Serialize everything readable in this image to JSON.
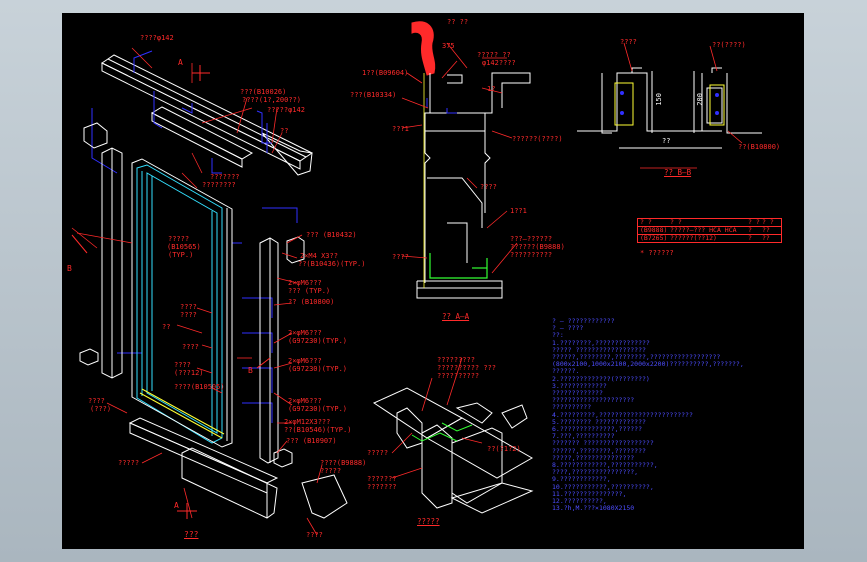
{
  "drawing": {
    "main_title": "???",
    "detail_title": "?????",
    "section_aa": "?? A—A",
    "section_bb": "?? B—B"
  },
  "callouts_left": {
    "top_rail": "????φ142",
    "b810055": "???(B10026)",
    "b810055_sub": "????(1?,200??)",
    "phi142": "?????φ142",
    "q2": "??",
    "quote3": "???????",
    "quote3b": "????????",
    "screw1": "?????",
    "b10565": "(B10565)",
    "b10565_typ": "(TYP.)",
    "b10432": "??? (B10432)",
    "screw_m4": "2×M4 X3??",
    "screw_m4_typ": "??(B10436)(TYP.)",
    "screw_m6_1": "2×φM6???",
    "screw_m6_1_typ": "??? (TYP.)",
    "b10800": "?? (B10800)",
    "m6_2": "2×φM6???",
    "m6_2_typ": "(G97230)(TYP.)",
    "m6_3": "2×φM6???",
    "m6_3_typ": "(G97230)(TYP.)",
    "m6_4": "2×φM6???",
    "m6_4_typ": "(G97230)(TYP.)",
    "m12": "2×φM12X3???",
    "m12_typ": "??(B10546)(TYP.)",
    "b10907": "??? (B10907)",
    "mid_1": "????",
    "mid_2": "????",
    "mid_3": "??",
    "mid_4": "????",
    "mid_5": "????",
    "mid_6": "(???12)",
    "b10505": "????(B10505)",
    "bot_1": "????",
    "bot_1b": "(???)",
    "bot_2": "?????",
    "profile_1": "????(B9888)",
    "profile_2": "?????",
    "profile_3": "????",
    "arrow_b": "B",
    "arrow_a": "A"
  },
  "callouts_mid": {
    "top_r1": "?? ??",
    "dim_top": "375",
    "r2": "????? ??",
    "r2b": "φ142????",
    "r3": "1??(B09604)",
    "r4": "???(B10334)",
    "r5": "???1",
    "r6": "1?",
    "r7": "??????(????)",
    "r8": "????",
    "r9": "1??1",
    "r10": "???—??????",
    "r10b": "??????(B9888)",
    "r10c": "??????????",
    "r11": "????",
    "r12": "??????? ???",
    "r13": "?????"
  },
  "callouts_detail": {
    "d1": "?????????",
    "d1b": "?????????? ???",
    "d1c": "??????????",
    "d2": "??(?1?2)",
    "d3": "?????",
    "d4": "???????",
    "d5": "???????"
  },
  "section_bb_labels": {
    "l1": "????",
    "l2": "??(????)",
    "dim_150": "150",
    "dim_200": "200",
    "dim_10": "??",
    "b10800": "??(B10800)"
  },
  "table": {
    "header": [
      "? ?",
      "? ?",
      "? ?",
      "? ?"
    ],
    "rows": [
      [
        "(B9888)",
        "?????—??? HCA HCA",
        "?",
        "??"
      ],
      [
        "(B7265)",
        "??????(??12)",
        "?",
        "??"
      ]
    ],
    "note": "* ??????"
  },
  "notes": [
    "? — ????????????",
    "? — ????",
    "??:",
    "1.????????,??????????????",
    "  ?????  ??????????????????",
    "  ??????,????????,????????,??????????????????",
    "  (800x2100,1000x2100,2000x2200)??????????,???????,",
    "  ??????.",
    "2.?????????????(????????)",
    "3.????????????",
    "  ?????????????",
    "  ?????????????????????",
    "    ??????????",
    "4.?????????,????????????????????????",
    "5.???????? ?????????????",
    "6.??????????????,??????",
    "7.???,??????????",
    "  ???????  ??????????????????",
    "  ??????,????????,????????",
    "  ?????,???????????????",
    "8.????????????,???????????,",
    "  ????,????????????????,",
    "9.????????????,",
    "10.???????????,??????????,",
    "11.???????????????,",
    "12.??????????,",
    "13.?h,M.???×1080X2150"
  ],
  "colors": {
    "background": "#000000",
    "frame": "#b8c3cb",
    "red": "#ff2a2a",
    "blue": "#3030ff",
    "white": "#ffffff",
    "cyan": "#33e0ff",
    "yellow": "#ffff33",
    "green": "#33ff33"
  }
}
